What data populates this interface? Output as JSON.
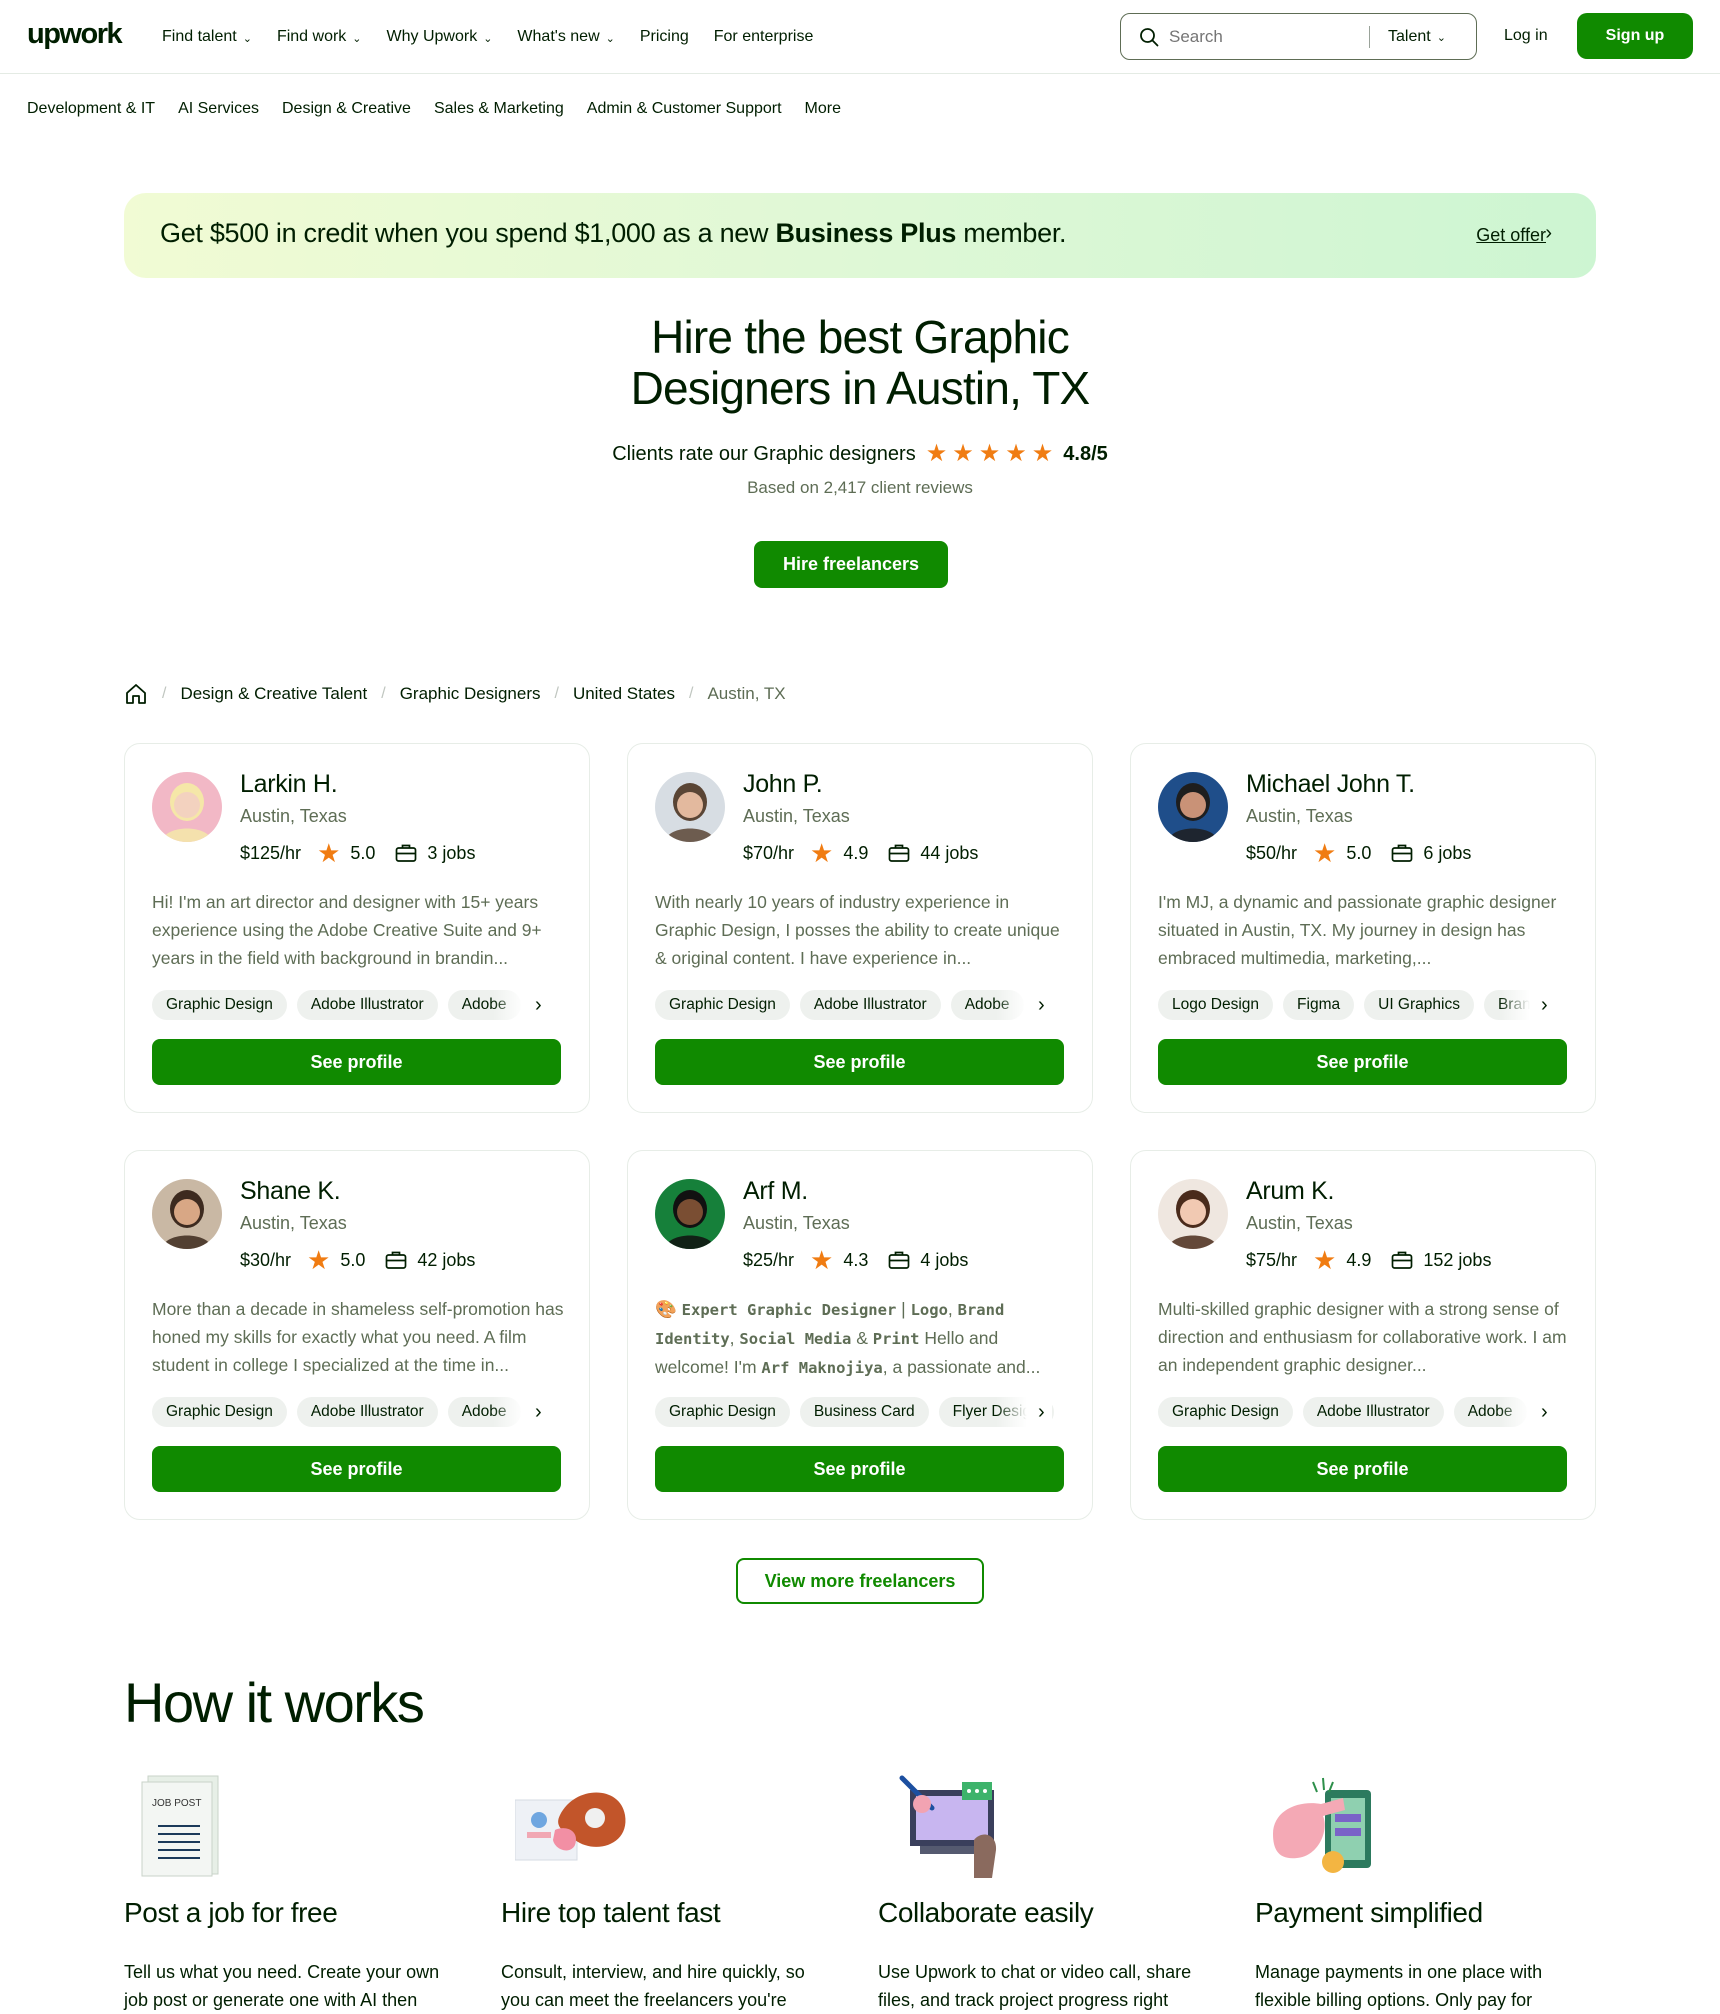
{
  "header": {
    "logo": "upwork",
    "nav": [
      {
        "label": "Find talent",
        "has_menu": true
      },
      {
        "label": "Find work",
        "has_menu": true
      },
      {
        "label": "Why Upwork",
        "has_menu": true
      },
      {
        "label": "What's new",
        "has_menu": true
      },
      {
        "label": "Pricing",
        "has_menu": false
      },
      {
        "label": "For enterprise",
        "has_menu": false
      }
    ],
    "search": {
      "placeholder": "Search",
      "scope": "Talent"
    },
    "login": "Log in",
    "signup": "Sign up"
  },
  "subnav": [
    "Development & IT",
    "AI Services",
    "Design & Creative",
    "Sales & Marketing",
    "Admin & Customer Support",
    "More"
  ],
  "promo": {
    "text_before": "Get $500 in credit when you spend $1,000 as a new ",
    "text_bold": "Business Plus",
    "text_after": " member.",
    "link": "Get offer"
  },
  "hero": {
    "title_line1": "Hire the best Graphic",
    "title_line2": "Designers in Austin, TX",
    "rating_label": "Clients rate our Graphic designers",
    "stars": 5,
    "rating_value": "4.8/5",
    "based_on": "Based on 2,417 client reviews",
    "cta": "Hire freelancers"
  },
  "breadcrumb": [
    "Design & Creative Talent",
    "Graphic Designers",
    "United States",
    "Austin, TX"
  ],
  "freelancers": [
    {
      "name": "Larkin H.",
      "location": "Austin, Texas",
      "rate": "$125/hr",
      "rating": "5.0",
      "jobs": "3 jobs",
      "bio": "Hi! I'm an art director and designer with 15+ years experience using the Adobe Creative Suite and 9+ years in the field with background in brandin...",
      "skills": [
        "Graphic Design",
        "Adobe Illustrator",
        "Adobe"
      ],
      "cta": "See profile"
    },
    {
      "name": "John P.",
      "location": "Austin, Texas",
      "rate": "$70/hr",
      "rating": "4.9",
      "jobs": "44 jobs",
      "bio": "With nearly 10 years of industry experience in Graphic Design, I posses the ability to create unique & original content. I have experience in...",
      "skills": [
        "Graphic Design",
        "Adobe Illustrator",
        "Adobe"
      ],
      "cta": "See profile"
    },
    {
      "name": "Michael John T.",
      "location": "Austin, Texas",
      "rate": "$50/hr",
      "rating": "5.0",
      "jobs": "6 jobs",
      "bio": "I'm MJ, a dynamic and passionate graphic designer situated in Austin, TX. My journey in design has embraced multimedia, marketing,...",
      "skills": [
        "Logo Design",
        "Figma",
        "UI Graphics",
        "Brand"
      ],
      "cta": "See profile"
    },
    {
      "name": "Shane K.",
      "location": "Austin, Texas",
      "rate": "$30/hr",
      "rating": "5.0",
      "jobs": "42 jobs",
      "bio": "More than a decade in shameless self-promotion has honed my skills for exactly what you need. A film student in college I specialized at the time in...",
      "skills": [
        "Graphic Design",
        "Adobe Illustrator",
        "Adobe"
      ],
      "cta": "See profile"
    },
    {
      "name": "Arf M.",
      "location": "Austin, Texas",
      "rate": "$25/hr",
      "rating": "4.3",
      "jobs": "4 jobs",
      "bio_parts": [
        {
          "t": "🎨 ",
          "mono": false
        },
        {
          "t": "Expert Graphic Designer",
          "mono": true
        },
        {
          "t": " | ",
          "mono": false
        },
        {
          "t": "Logo",
          "mono": true
        },
        {
          "t": ", ",
          "mono": false
        },
        {
          "t": "Brand Identity",
          "mono": true
        },
        {
          "t": ", ",
          "mono": false
        },
        {
          "t": "Social Media",
          "mono": true
        },
        {
          "t": " & ",
          "mono": false
        },
        {
          "t": "Print",
          "mono": true
        },
        {
          "t": " Hello and welcome! I'm ",
          "mono": false
        },
        {
          "t": "Arf Maknojiya",
          "mono": true
        },
        {
          "t": ", a passionate and...",
          "mono": false
        }
      ],
      "skills": [
        "Graphic Design",
        "Business Card",
        "Flyer Design"
      ],
      "cta": "See profile"
    },
    {
      "name": "Arum K.",
      "location": "Austin, Texas",
      "rate": "$75/hr",
      "rating": "4.9",
      "jobs": "152 jobs",
      "bio": "Multi-skilled graphic designer with a strong sense of direction and enthusiasm for collaborative work. I am an independent graphic designer...",
      "skills": [
        "Graphic Design",
        "Adobe Illustrator",
        "Adobe"
      ],
      "cta": "See profile"
    }
  ],
  "view_more": "View more freelancers",
  "how_it_works": {
    "title": "How it works",
    "steps": [
      {
        "icon": "job-post-icon",
        "illus_text": "JOB POST",
        "title": "Post a job for free",
        "desc": "Tell us what you need. Create your own job post or generate one with AI then"
      },
      {
        "icon": "hire-talent-icon",
        "title": "Hire top talent fast",
        "desc": "Consult, interview, and hire quickly, so you can meet the freelancers you're"
      },
      {
        "icon": "collaborate-icon",
        "title": "Collaborate easily",
        "desc": "Use Upwork to chat or video call, share files, and track project progress right"
      },
      {
        "icon": "payment-icon",
        "title": "Payment simplified",
        "desc": "Manage payments in one place with flexible billing options. Only pay for"
      }
    ]
  },
  "colors": {
    "brand_green": "#108a00",
    "text": "#001e00",
    "muted": "#5e6d55",
    "star": "#f07c12"
  }
}
